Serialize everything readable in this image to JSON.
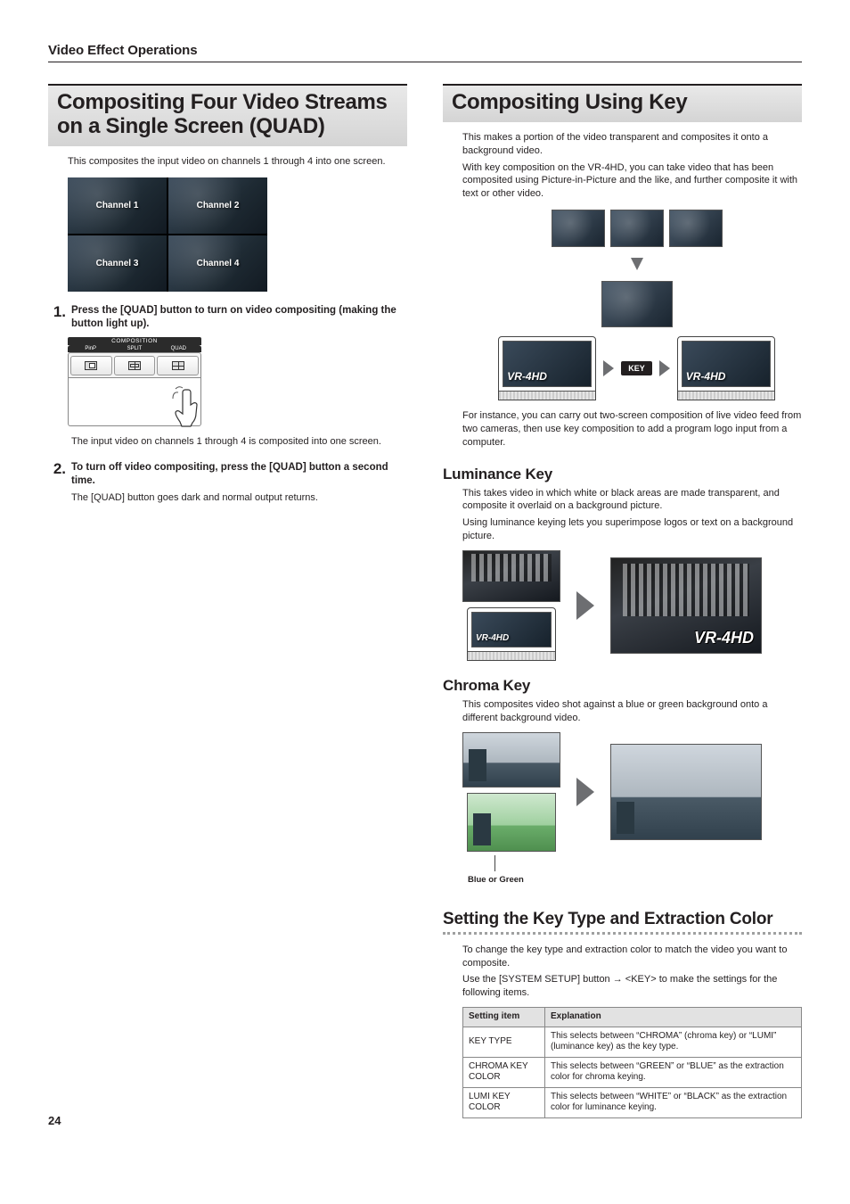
{
  "page_number": "24",
  "section_head": "Video Effect Operations",
  "left": {
    "banner": "Compositing Four Video Streams on a Single Screen (QUAD)",
    "intro": "This composites the input video on channels 1 through 4 into one screen.",
    "quad_cells": [
      "Channel 1",
      "Channel 2",
      "Channel 3",
      "Channel 4"
    ],
    "panel_title": "COMPOSITION",
    "panel_buttons": [
      "PinP",
      "SPLIT",
      "QUAD"
    ],
    "step1_num": "1.",
    "step1_text": "Press the [QUAD] button to turn on video compositing (making the button light up).",
    "step1_sub": "The input video on channels 1 through 4 is composited into one screen.",
    "step2_num": "2.",
    "step2_text": "To turn off video compositing, press the [QUAD] button a second time.",
    "step2_sub": "The [QUAD] button goes dark and normal output returns."
  },
  "right": {
    "banner": "Compositing Using Key",
    "p1": "This makes a portion of the video transparent and composites it onto a background video.",
    "p2": "With key composition on the VR-4HD, you can take video that has been composited using Picture-in-Picture and the like, and further composite it with text or other video.",
    "flow_device": "VR-4HD",
    "flow_key_badge": "KEY",
    "p3": "For instance, you can carry out two-screen composition of live video feed from two cameras, then use key composition to add a program logo input from a computer.",
    "luma_h": "Luminance Key",
    "luma_p1": "This takes video in which white or black areas are made transparent, and composite it overlaid on a background picture.",
    "luma_p2": "Using luminance keying lets you superimpose logos or text on a background picture.",
    "luma_logo": "VR-4HD",
    "chroma_h": "Chroma Key",
    "chroma_p": "This composites video shot against a blue or green background onto a different background video.",
    "chroma_caption": "Blue or Green",
    "setkey_h": "Setting the Key Type and Extraction Color",
    "setkey_p1": "To change the key type and extraction color to match the video you want to composite.",
    "setkey_p2": "Use the [SYSTEM SETUP] button → <KEY> to make the settings for the following items.",
    "table": {
      "headers": [
        "Setting item",
        "Explanation"
      ],
      "rows": [
        [
          "KEY TYPE",
          "This selects between “CHROMA” (chroma key) or “LUMI” (luminance key) as the key type."
        ],
        [
          "CHROMA KEY COLOR",
          "This selects between “GREEN” or “BLUE” as the extraction color for chroma keying."
        ],
        [
          "LUMI KEY COLOR",
          "This selects between “WHITE” or “BLACK” as the extraction color for luminance keying."
        ]
      ]
    }
  }
}
